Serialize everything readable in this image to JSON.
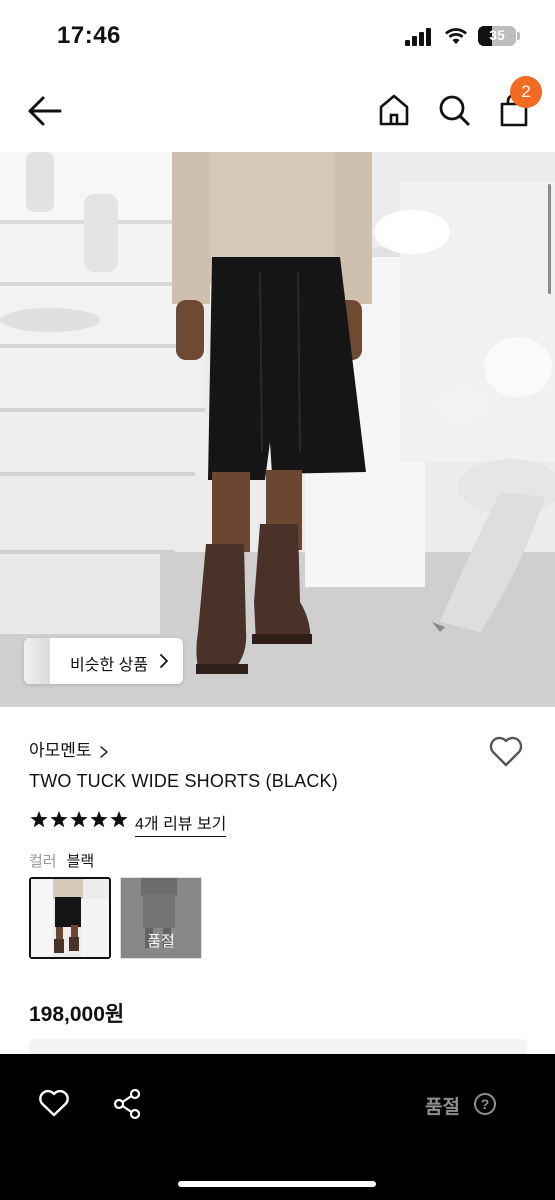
{
  "status_bar": {
    "time": "17:46",
    "battery": "35"
  },
  "nav": {
    "back_icon": "arrow-left-icon",
    "home_icon": "home-icon",
    "search_icon": "search-icon",
    "cart_icon": "shopping-bag-icon",
    "cart_badge": "2"
  },
  "hero": {
    "similar_button_label": "비슷한 상품"
  },
  "product": {
    "brand": "아모멘토",
    "title": "TWO TUCK WIDE SHORTS (BLACK)",
    "rating_stars": 5,
    "review_link": "4개 리뷰 보기",
    "color_label": "컬러",
    "color_value": "블랙",
    "swatches": [
      {
        "state": "selected"
      },
      {
        "label": "품절"
      }
    ],
    "price": "198,000원"
  },
  "bottom_bar": {
    "status": "품절",
    "help_symbol": "?"
  },
  "colors": {
    "accent": "#f26b22",
    "bar": "#000000",
    "disabled_text": "#8f8f8f"
  }
}
